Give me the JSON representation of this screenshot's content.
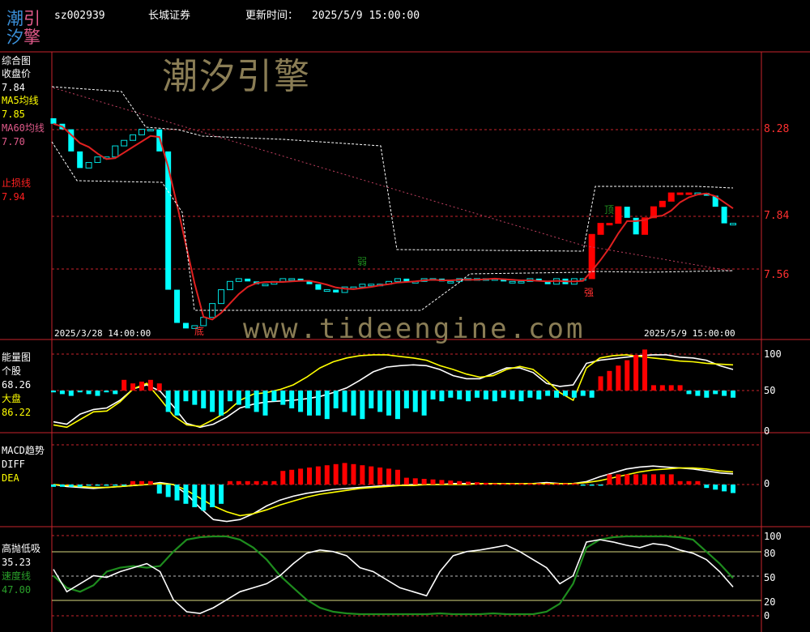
{
  "logo": {
    "line1_a": "潮",
    "line1_b": "引",
    "line2_a": "汐",
    "line2_b": "擎"
  },
  "header": {
    "code": "sz002939",
    "name": "长城证券",
    "update_label": "更新时间：",
    "update_time": "2025/5/9 15:00:00"
  },
  "watermark": {
    "brand": "潮汐引擎",
    "url": "www.tideengine.com"
  },
  "colors": {
    "background": "#000000",
    "grid": "#c8232c",
    "ma5": "#ffff00",
    "ma60": "#e05a8a",
    "stop": "#ff2020",
    "up": "#ff0000",
    "down": "#00ffff",
    "white_line": "#ffffff",
    "speed": "#1e8c1e"
  },
  "panel_main": {
    "title": "综合图",
    "close_label": "收盘价",
    "close_value": "7.84",
    "ma5_label": "MA5均线",
    "ma5_value": "7.85",
    "ma60_label": "MA60均线",
    "ma60_value": "7.70",
    "stop_label": "止损线",
    "stop_value": "7.94",
    "price_axis": [
      "8.28",
      "7.84",
      "7.56"
    ],
    "start_time": "2025/3/28 14:00:00",
    "end_time": "2025/5/9 15:00:00",
    "marker_bottom": "底",
    "marker_weak": "弱",
    "marker_strong": "强",
    "marker_top": "顶"
  },
  "panel_energy": {
    "title": "能量图",
    "stock_label": "个股",
    "stock_value": "68.26",
    "market_label": "大盘",
    "market_value": "86.22",
    "axis": [
      "100",
      "50",
      "0"
    ]
  },
  "panel_macd": {
    "title": "MACD趋势",
    "diff_label": "DIFF",
    "dea_label": "DEA",
    "axis": [
      "0"
    ]
  },
  "panel_kdj": {
    "title": "高抛低吸",
    "value1": "35.23",
    "speed_label": "速度线",
    "speed_value": "47.00",
    "axis": [
      "100",
      "80",
      "50",
      "20",
      "0"
    ]
  },
  "chart_data": {
    "type": "line",
    "title": "sz002939 长城证券",
    "x_range": [
      "2025/3/28 14:00:00",
      "2025/5/9 15:00:00"
    ],
    "main": {
      "ylim": [
        7.42,
        8.46
      ],
      "close": [
        8.2,
        8.18,
        8.1,
        8.04,
        8.06,
        8.08,
        8.08,
        8.12,
        8.14,
        8.16,
        8.18,
        8.18,
        8.1,
        7.6,
        7.48,
        7.46,
        7.47,
        7.5,
        7.55,
        7.6,
        7.63,
        7.64,
        7.63,
        7.62,
        7.62,
        7.63,
        7.64,
        7.64,
        7.63,
        7.62,
        7.6,
        7.6,
        7.59,
        7.61,
        7.61,
        7.62,
        7.62,
        7.62,
        7.63,
        7.64,
        7.63,
        7.63,
        7.64,
        7.64,
        7.63,
        7.63,
        7.64,
        7.64,
        7.64,
        7.64,
        7.64,
        7.63,
        7.63,
        7.63,
        7.64,
        7.63,
        7.62,
        7.64,
        7.62,
        7.64,
        7.64,
        7.8,
        7.84,
        7.84,
        7.9,
        7.86,
        7.8,
        7.86,
        7.9,
        7.92,
        7.95,
        7.95,
        7.95,
        7.95,
        7.94,
        7.9,
        7.84,
        7.84
      ],
      "ma5_series": "MA5均线",
      "ma60_series": "MA60均线"
    },
    "energy": {
      "ylim": [
        0,
        100
      ],
      "stock_last": 68.26,
      "market_last": 86.22
    },
    "kdj": {
      "ylim": [
        0,
        100
      ],
      "levels": [
        80,
        50,
        20
      ],
      "value_last": 35.23,
      "speed_last": 47.0
    }
  }
}
